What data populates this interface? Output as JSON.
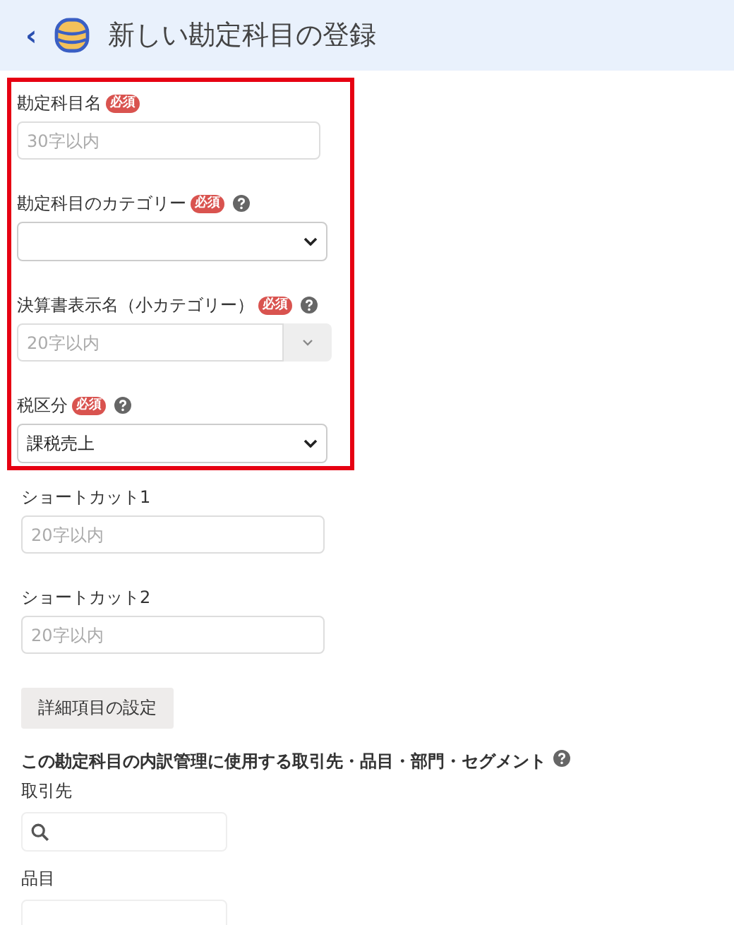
{
  "header": {
    "back": "‹",
    "title": "新しい勘定科目の登録"
  },
  "highlighted_fields": [
    {
      "kind": "text",
      "label": "勘定科目名",
      "badge": "必須",
      "placeholder": "30字以内"
    },
    {
      "kind": "select",
      "label": "勘定科目のカテゴリー",
      "badge": "必須",
      "help": true
    },
    {
      "kind": "combo",
      "label": "決算書表示名（小カテゴリー）",
      "badge": "必須",
      "help": true,
      "placeholder": "20字以内"
    },
    {
      "kind": "select",
      "label": "税区分",
      "badge": "必須",
      "help": true,
      "value": "課税売上"
    }
  ],
  "fields": [
    {
      "kind": "text",
      "label": "ショートカット1",
      "placeholder": "20字以内"
    },
    {
      "kind": "text",
      "label": "ショートカット2",
      "placeholder": "20字以内"
    }
  ],
  "detail_button": "詳細項目の設定",
  "breakdown": {
    "heading": "この勘定科目の内訳管理に使用する取引先・品目・部門・セグメント",
    "fields": [
      {
        "kind": "search",
        "label": "取引先"
      },
      {
        "kind": "cut",
        "label": "品目"
      }
    ]
  }
}
